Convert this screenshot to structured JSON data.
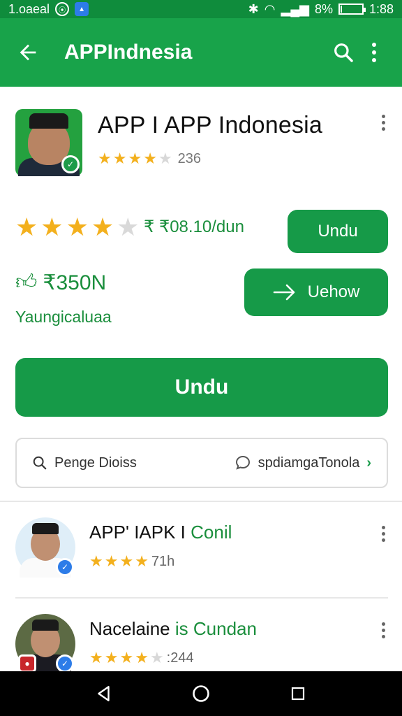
{
  "status_bar": {
    "carrier": "1.oaeal",
    "battery": "8%",
    "time": "1:88",
    "battery_fraction": 0.08
  },
  "app_bar": {
    "title": "APPIndnesia",
    "back_icon": "arrow-left-icon",
    "search_icon": "search-icon",
    "menu_icon": "more-vertical-icon"
  },
  "app": {
    "title": "APP I APP Indonesia",
    "rating_stars": 3.5,
    "rating_count": "236",
    "menu_icon": "more-vertical-icon"
  },
  "details": {
    "rating_stars": 3.5,
    "price_text": "₹ ₹08.10/dun",
    "download_small_label": "Undu",
    "size_text": "₹350N",
    "subtitle": "Yaungicaluaa",
    "next_button_label": "Uehow",
    "main_button_label": "Undu"
  },
  "infobar": {
    "left_label": "Penge Dioiss",
    "right_label": "spdiamgaTonola"
  },
  "related": [
    {
      "title_black": "APP' IAPK I",
      "title_green": "Conil",
      "stars": 4,
      "count": "71h"
    },
    {
      "title_black": "Nacelaine",
      "title_green": "is Cundan",
      "stars": 3.5,
      "count": ":244"
    }
  ],
  "colors": {
    "status_bar": "#0f8c3c",
    "app_bar": "#18a34a",
    "accent_green": "#169a48",
    "star": "#f3b01d"
  }
}
